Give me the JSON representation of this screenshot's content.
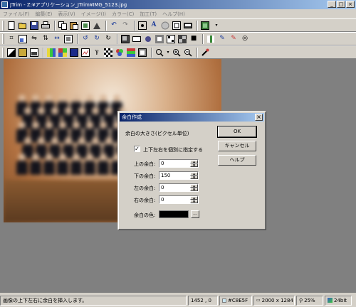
{
  "window": {
    "title": "JTrim - Z:¥アプリケーション_JTrim¥IMG_5123.jpg",
    "buttons": [
      "_",
      "□",
      "×"
    ]
  },
  "menu": [
    "ファイル(F)",
    "編集(E)",
    "表示(V)",
    "イメージ(I)",
    "カラー(C)",
    "加工(T)",
    "ヘルプ(H)"
  ],
  "toolbar": {
    "row1": [
      "new-icon",
      "open-icon",
      "save-icon",
      "print-icon",
      "copy-icon",
      "paste-icon",
      "trim-icon",
      "undo-icon",
      "redo-icon",
      "fit-icon",
      "text-icon",
      "circle-icon",
      "frame-icon",
      "border-icon",
      "display-icon"
    ],
    "row2": [
      "crop-icon",
      "resize-icon",
      "flip-icon",
      "mirror-icon",
      "rotate-left-icon",
      "rotate-right-icon",
      "shadow-icon",
      "mask-icon",
      "blur-icon",
      "sharpen-icon",
      "noise-icon",
      "mosaic-icon",
      "pen-icon",
      "eraser-icon",
      "spiral-icon"
    ],
    "row3": [
      "contrast-icon",
      "color-icon",
      "gradient-icon",
      "palette-icon",
      "tone-icon",
      "gamma-icon",
      "dither-icon",
      "rgb-icon",
      "gray-icon",
      "search-icon",
      "zoom-in-icon",
      "zoom-out-icon",
      "eyedropper-icon"
    ]
  },
  "dialog": {
    "title": "余白作成",
    "close": "×",
    "size_label": "余白の大きさ(ピクセル単位)",
    "checkbox_label": "上下左右を個別に指定する",
    "checkbox_checked": true,
    "checkbox_mark": "✓",
    "fields": [
      {
        "label": "上の余白:",
        "value": "0"
      },
      {
        "label": "下の余白:",
        "value": "150"
      },
      {
        "label": "左の余白:",
        "value": "0"
      },
      {
        "label": "右の余白:",
        "value": "0"
      }
    ],
    "color_label": "余白の色:",
    "color_value": "#000000",
    "color_button": "...",
    "buttons": {
      "ok": "OK",
      "cancel": "キャンセル",
      "help": "ヘルプ"
    }
  },
  "status": {
    "message": "画像の上下左右に余白を挿入します。",
    "coords": "1452 , 0",
    "color": "#C8E5F",
    "size": "2000 x 1284",
    "zoom": "25%",
    "depth": "24bit"
  }
}
